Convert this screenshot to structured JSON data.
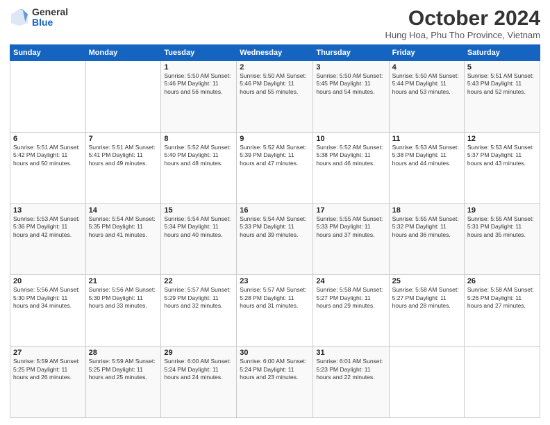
{
  "header": {
    "logo_general": "General",
    "logo_blue": "Blue",
    "month_title": "October 2024",
    "subtitle": "Hung Hoa, Phu Tho Province, Vietnam"
  },
  "weekdays": [
    "Sunday",
    "Monday",
    "Tuesday",
    "Wednesday",
    "Thursday",
    "Friday",
    "Saturday"
  ],
  "weeks": [
    [
      {
        "day": "",
        "info": ""
      },
      {
        "day": "",
        "info": ""
      },
      {
        "day": "1",
        "info": "Sunrise: 5:50 AM\nSunset: 5:46 PM\nDaylight: 11 hours\nand 56 minutes."
      },
      {
        "day": "2",
        "info": "Sunrise: 5:50 AM\nSunset: 5:46 PM\nDaylight: 11 hours\nand 55 minutes."
      },
      {
        "day": "3",
        "info": "Sunrise: 5:50 AM\nSunset: 5:45 PM\nDaylight: 11 hours\nand 54 minutes."
      },
      {
        "day": "4",
        "info": "Sunrise: 5:50 AM\nSunset: 5:44 PM\nDaylight: 11 hours\nand 53 minutes."
      },
      {
        "day": "5",
        "info": "Sunrise: 5:51 AM\nSunset: 5:43 PM\nDaylight: 11 hours\nand 52 minutes."
      }
    ],
    [
      {
        "day": "6",
        "info": "Sunrise: 5:51 AM\nSunset: 5:42 PM\nDaylight: 11 hours\nand 50 minutes."
      },
      {
        "day": "7",
        "info": "Sunrise: 5:51 AM\nSunset: 5:41 PM\nDaylight: 11 hours\nand 49 minutes."
      },
      {
        "day": "8",
        "info": "Sunrise: 5:52 AM\nSunset: 5:40 PM\nDaylight: 11 hours\nand 48 minutes."
      },
      {
        "day": "9",
        "info": "Sunrise: 5:52 AM\nSunset: 5:39 PM\nDaylight: 11 hours\nand 47 minutes."
      },
      {
        "day": "10",
        "info": "Sunrise: 5:52 AM\nSunset: 5:38 PM\nDaylight: 11 hours\nand 46 minutes."
      },
      {
        "day": "11",
        "info": "Sunrise: 5:53 AM\nSunset: 5:38 PM\nDaylight: 11 hours\nand 44 minutes."
      },
      {
        "day": "12",
        "info": "Sunrise: 5:53 AM\nSunset: 5:37 PM\nDaylight: 11 hours\nand 43 minutes."
      }
    ],
    [
      {
        "day": "13",
        "info": "Sunrise: 5:53 AM\nSunset: 5:36 PM\nDaylight: 11 hours\nand 42 minutes."
      },
      {
        "day": "14",
        "info": "Sunrise: 5:54 AM\nSunset: 5:35 PM\nDaylight: 11 hours\nand 41 minutes."
      },
      {
        "day": "15",
        "info": "Sunrise: 5:54 AM\nSunset: 5:34 PM\nDaylight: 11 hours\nand 40 minutes."
      },
      {
        "day": "16",
        "info": "Sunrise: 5:54 AM\nSunset: 5:33 PM\nDaylight: 11 hours\nand 39 minutes."
      },
      {
        "day": "17",
        "info": "Sunrise: 5:55 AM\nSunset: 5:33 PM\nDaylight: 11 hours\nand 37 minutes."
      },
      {
        "day": "18",
        "info": "Sunrise: 5:55 AM\nSunset: 5:32 PM\nDaylight: 11 hours\nand 36 minutes."
      },
      {
        "day": "19",
        "info": "Sunrise: 5:55 AM\nSunset: 5:31 PM\nDaylight: 11 hours\nand 35 minutes."
      }
    ],
    [
      {
        "day": "20",
        "info": "Sunrise: 5:56 AM\nSunset: 5:30 PM\nDaylight: 11 hours\nand 34 minutes."
      },
      {
        "day": "21",
        "info": "Sunrise: 5:56 AM\nSunset: 5:30 PM\nDaylight: 11 hours\nand 33 minutes."
      },
      {
        "day": "22",
        "info": "Sunrise: 5:57 AM\nSunset: 5:29 PM\nDaylight: 11 hours\nand 32 minutes."
      },
      {
        "day": "23",
        "info": "Sunrise: 5:57 AM\nSunset: 5:28 PM\nDaylight: 11 hours\nand 31 minutes."
      },
      {
        "day": "24",
        "info": "Sunrise: 5:58 AM\nSunset: 5:27 PM\nDaylight: 11 hours\nand 29 minutes."
      },
      {
        "day": "25",
        "info": "Sunrise: 5:58 AM\nSunset: 5:27 PM\nDaylight: 11 hours\nand 28 minutes."
      },
      {
        "day": "26",
        "info": "Sunrise: 5:58 AM\nSunset: 5:26 PM\nDaylight: 11 hours\nand 27 minutes."
      }
    ],
    [
      {
        "day": "27",
        "info": "Sunrise: 5:59 AM\nSunset: 5:25 PM\nDaylight: 11 hours\nand 26 minutes."
      },
      {
        "day": "28",
        "info": "Sunrise: 5:59 AM\nSunset: 5:25 PM\nDaylight: 11 hours\nand 25 minutes."
      },
      {
        "day": "29",
        "info": "Sunrise: 6:00 AM\nSunset: 5:24 PM\nDaylight: 11 hours\nand 24 minutes."
      },
      {
        "day": "30",
        "info": "Sunrise: 6:00 AM\nSunset: 5:24 PM\nDaylight: 11 hours\nand 23 minutes."
      },
      {
        "day": "31",
        "info": "Sunrise: 6:01 AM\nSunset: 5:23 PM\nDaylight: 11 hours\nand 22 minutes."
      },
      {
        "day": "",
        "info": ""
      },
      {
        "day": "",
        "info": ""
      }
    ]
  ]
}
